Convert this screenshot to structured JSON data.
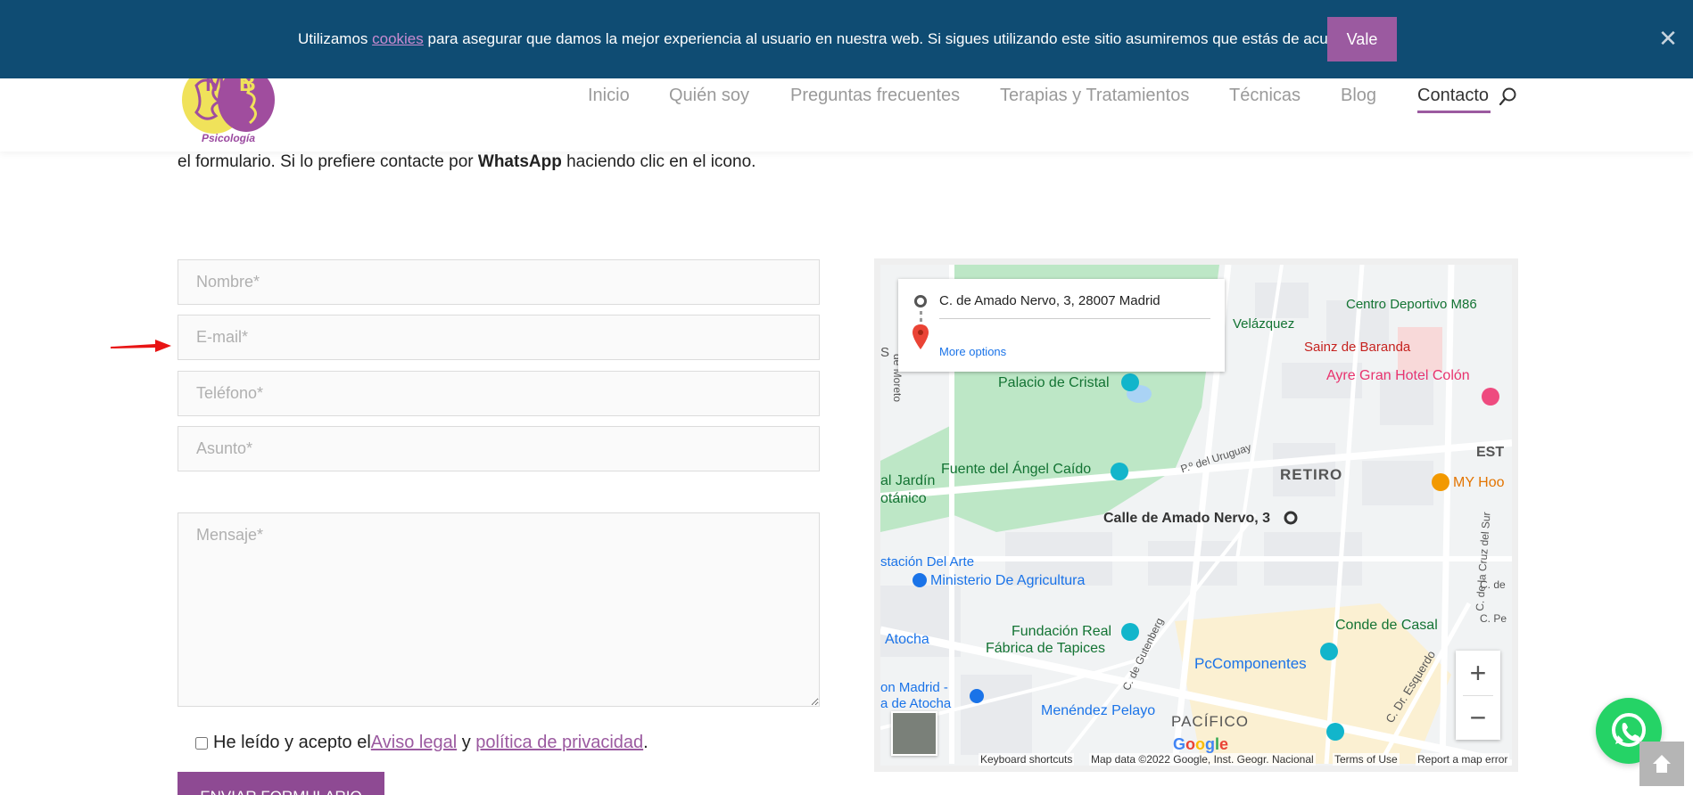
{
  "cookie_bar": {
    "text_before": "Utilizamos ",
    "link_label": "cookies",
    "text_after": " para asegurar que damos la mejor experiencia al usuario en nuestra web. Si sigues utilizando este sitio asumiremos que estás de acuerdo.",
    "accept_label": "Vale",
    "close_label": "✕"
  },
  "header": {
    "logo_text": "Psicología",
    "nav": [
      {
        "label": "Inicio",
        "active": false
      },
      {
        "label": "Quién soy",
        "active": false
      },
      {
        "label": "Preguntas frecuentes",
        "active": false
      },
      {
        "label": "Terapias y Tratamientos",
        "active": false
      },
      {
        "label": "Técnicas",
        "active": false
      },
      {
        "label": "Blog",
        "active": false
      },
      {
        "label": "Contacto",
        "active": true
      }
    ],
    "search_icon": "search-icon",
    "active_color": "#9b5aa0"
  },
  "intro": {
    "text_before": "el formulario.  Si lo prefiere contacte por ",
    "bold": "WhatsApp",
    "text_after": " haciendo clic en el icono."
  },
  "form": {
    "name_placeholder": "Nombre*",
    "email_placeholder": "E-mail*",
    "phone_placeholder": "Teléfono*",
    "subject_placeholder": "Asunto*",
    "message_placeholder": "Mensaje*",
    "consent_before": "He leído y acepto el",
    "consent_legal": " Aviso legal",
    "consent_and": " y ",
    "consent_privacy": "política de privacidad",
    "consent_end": ".",
    "submit_label": "ENVIAR FORMULARIO"
  },
  "map": {
    "address": "C. de Amado Nervo, 3, 28007 Madrid",
    "more_options": "More options",
    "zoom_in": "+",
    "zoom_out": "−",
    "google_letters": [
      "G",
      "o",
      "o",
      "g",
      "l",
      "e"
    ],
    "footer": {
      "shortcuts": "Keyboard shortcuts",
      "map_data": "Map data ©2022 Google, Inst. Geogr. Nacional",
      "terms": "Terms of Use",
      "report": "Report a map error"
    },
    "labels": {
      "centro_deportivo": "Centro Deportivo M86",
      "velazquez": "Velázquez",
      "sainz": "Sainz de Baranda",
      "ayre": "Ayre Gran Hotel Colón",
      "palacio": "Palacio de Cristal",
      "del_uruguay": "P.º del Uruguay",
      "fuente": "Fuente del Ángel Caído",
      "retiro": "RETIRO",
      "my_hoo": "MY Hoo",
      "jardin": "al Jardín",
      "botanico": "otánico",
      "amado": "Calle de Amado Nervo, 3",
      "estacion": "stación Del Arte",
      "ministerio": "Ministerio De Agricultura",
      "fundacion1": "Fundación Real",
      "fundacion2": "Fábrica de Tapices",
      "conde": "Conde de Casal",
      "atocha": "Atocha",
      "pccomponentes": "PcComponentes",
      "madrid_atocha1": "on Madrid -",
      "madrid_atocha2": "a de Atocha",
      "menendez": "Menéndez Pelayo",
      "pacifico": "PACÍFICO",
      "gutenberg": "C. de Gutenberg",
      "esquerdo": "C. Dr. Esquerdo",
      "moreto": "de Moreto",
      "cruz_sur": "C. de la Cruz del Sur",
      "est": "EST",
      "s_cut": "S",
      "c_de": "C. de",
      "c_pe": "C. Pe"
    }
  },
  "floating": {
    "whatsapp_icon": "whatsapp-icon",
    "to_top_icon": "arrow-up-icon"
  }
}
